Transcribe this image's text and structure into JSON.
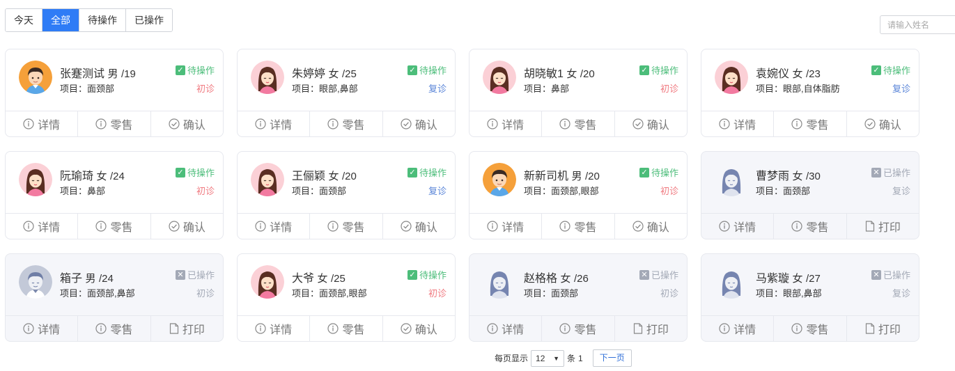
{
  "tabs": [
    "今天",
    "全部",
    "待操作",
    "已操作"
  ],
  "active_tab": 1,
  "search": {
    "placeholder": "请输入姓名"
  },
  "labels": {
    "project_prefix": "项目：",
    "detail": "详情",
    "retail": "零售",
    "confirm": "确认",
    "print": "打印"
  },
  "cards": [
    {
      "name": "张蹇测试",
      "gender": "男",
      "age": "/19",
      "project": "面颈部",
      "status": "待操作",
      "visit": "初诊",
      "avatar": "male-avatar-icon",
      "done": false
    },
    {
      "name": "朱婷婷",
      "gender": "女",
      "age": "/25",
      "project": "眼部,鼻部",
      "status": "待操作",
      "visit": "复诊",
      "avatar": "female-avatar-icon",
      "done": false
    },
    {
      "name": "胡晓敏1",
      "gender": "女",
      "age": "/20",
      "project": "鼻部",
      "status": "待操作",
      "visit": "初诊",
      "avatar": "female-avatar-icon",
      "done": false
    },
    {
      "name": "袁婉仪",
      "gender": "女",
      "age": "/23",
      "project": "眼部,自体脂肪",
      "status": "待操作",
      "visit": "复诊",
      "avatar": "female-avatar-icon",
      "done": false
    },
    {
      "name": "阮瑜琦",
      "gender": "女",
      "age": "/24",
      "project": "鼻部",
      "status": "待操作",
      "visit": "初诊",
      "avatar": "female-avatar-icon",
      "done": false
    },
    {
      "name": "王俪颖",
      "gender": "女",
      "age": "/20",
      "project": "面颈部",
      "status": "待操作",
      "visit": "复诊",
      "avatar": "female-avatar-icon",
      "done": false
    },
    {
      "name": "新新司机",
      "gender": "男",
      "age": "/20",
      "project": "面颈部,眼部",
      "status": "待操作",
      "visit": "初诊",
      "avatar": "male-avatar-icon",
      "done": false
    },
    {
      "name": "曹梦雨",
      "gender": "女",
      "age": "/30",
      "project": "面颈部",
      "status": "已操作",
      "visit": "复诊",
      "avatar": "female-avatar-gray-icon",
      "done": true
    },
    {
      "name": "箱子",
      "gender": "男",
      "age": "/24",
      "project": "面颈部,鼻部",
      "status": "已操作",
      "visit": "初诊",
      "avatar": "male-avatar-gray-icon",
      "done": true
    },
    {
      "name": "大爷",
      "gender": "女",
      "age": "/25",
      "project": "面颈部,眼部",
      "status": "待操作",
      "visit": "初诊",
      "avatar": "female-avatar-icon",
      "done": false
    },
    {
      "name": "赵格格",
      "gender": "女",
      "age": "/26",
      "project": "面颈部",
      "status": "已操作",
      "visit": "初诊",
      "avatar": "female-avatar-gray-icon",
      "done": true
    },
    {
      "name": "马紫璇",
      "gender": "女",
      "age": "/27",
      "project": "眼部,鼻部",
      "status": "已操作",
      "visit": "复诊",
      "avatar": "female-avatar-gray-icon",
      "done": true
    }
  ],
  "pager": {
    "per_page_label": "每页显示",
    "per_page_value": "12",
    "unit_label": "条",
    "page": "1",
    "next_label": "下一页"
  },
  "colors": {
    "accent": "#2f7cf6",
    "pending": "#4cbd7a",
    "handled": "#a3a9b6",
    "first_visit": "#f07a80",
    "return_visit": "#5a85d8"
  }
}
